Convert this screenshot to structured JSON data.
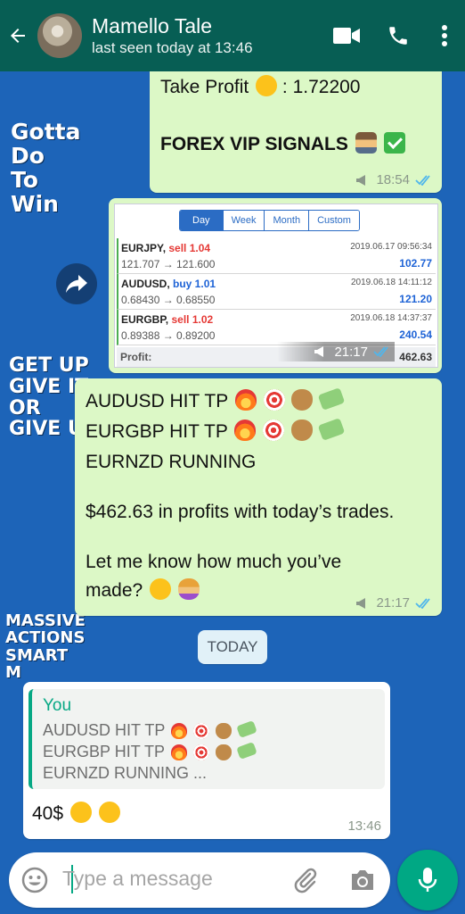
{
  "header": {
    "contact_name": "Mamello Tale",
    "last_seen": "last seen today at 13:46"
  },
  "wallpaper": {
    "block1": [
      "Gotta",
      "Do",
      "To",
      "Win"
    ],
    "block2": [
      "GET UP",
      "GIVE IT",
      "OR",
      "GIVE U"
    ],
    "block3": [
      "MASSIVE",
      "ACTIONS",
      "SMART",
      "M"
    ]
  },
  "messages": [
    {
      "id": "msg1",
      "direction": "outgoing",
      "lines": [
        "Take Profit",
        ": 1.72200",
        "FOREX VIP SIGNALS"
      ],
      "time": "18:54"
    },
    {
      "id": "msg2",
      "direction": "outgoing",
      "type": "image",
      "tabs": [
        "Day",
        "Week",
        "Month",
        "Custom"
      ],
      "active_tab": "Day",
      "trades": [
        {
          "symbol": "EURJPY,",
          "side": "sell 1.04",
          "prices": "121.707 → 121.600",
          "datetime": "2019.06.17 09:56:34",
          "profit": "102.77"
        },
        {
          "symbol": "AUDUSD,",
          "side": "buy 1.01",
          "prices": "0.68430 → 0.68550",
          "datetime": "2019.06.18 14:11:12",
          "profit": "121.20"
        },
        {
          "symbol": "EURGBP,",
          "side": "sell 1.02",
          "prices": "0.89388 → 0.89200",
          "datetime": "2019.06.18 14:37:37",
          "profit": "240.54"
        }
      ],
      "profit_label": "Profit:",
      "profit_total": "462.63",
      "time": "21:17"
    },
    {
      "id": "msg3",
      "direction": "outgoing",
      "lines": [
        "AUDUSD HIT TP",
        "EURGBP HIT TP",
        "EURNZD RUNNING",
        "$462.63 in profits with today’s trades.",
        "Let me know how much you’ve",
        "made?"
      ],
      "time": "21:17"
    },
    {
      "id": "msg4",
      "direction": "incoming",
      "reply_author": "You",
      "reply_lines": [
        "AUDUSD HIT TP",
        "EURGBP HIT TP",
        "EURNZD RUNNING ..."
      ],
      "text": "40$",
      "time": "13:46"
    }
  ],
  "date_chip": "TODAY",
  "composer": {
    "placeholder": "Type a message"
  },
  "icons": {
    "back": "arrow-left-icon",
    "video": "video-call-icon",
    "phone": "phone-icon",
    "menu": "more-vert-icon",
    "emoji": "emoji-icon",
    "attach": "paperclip-icon",
    "camera": "camera-icon",
    "mic": "microphone-icon",
    "forward": "forward-icon"
  },
  "colors": {
    "header": "#075e54",
    "outgoing_bubble": "#dcf8c6",
    "incoming_bubble": "#ffffff",
    "accent": "#00a884",
    "read_ticks": "#4fb6ec",
    "wallpaper": "#1d64b8"
  }
}
